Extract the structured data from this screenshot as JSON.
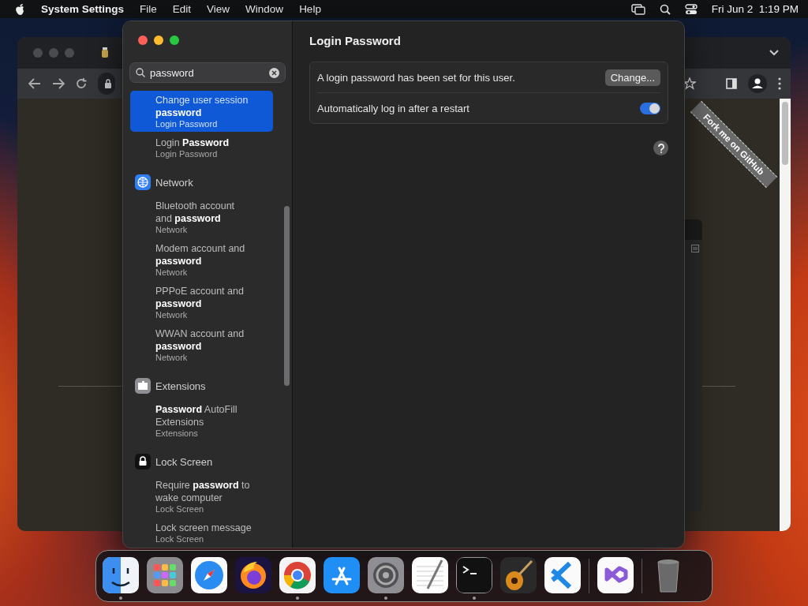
{
  "menu_bar": {
    "app_name": "System Settings",
    "menus": [
      "File",
      "Edit",
      "View",
      "Window",
      "Help"
    ],
    "clock": "Fri Jun 2  1:19 PM"
  },
  "browser": {
    "ribbon": "Fork me on GitHub"
  },
  "settings": {
    "search": {
      "value": "password"
    },
    "groups": [
      {
        "results": [
          {
            "title": "Change user session **password**",
            "subtitle": "Login Password",
            "selected": true
          },
          {
            "title": "Login **Password**",
            "subtitle": "Login Password",
            "selected": false
          }
        ]
      },
      {
        "heading": "Network",
        "results": [
          {
            "title": "Bluetooth account and **password**",
            "subtitle": "Network",
            "selected": false
          },
          {
            "title": "Modem account and **password**",
            "subtitle": "Network",
            "selected": false
          },
          {
            "title": "PPPoE account and **password**",
            "subtitle": "Network",
            "selected": false
          },
          {
            "title": "WWAN account and **password**",
            "subtitle": "Network",
            "selected": false
          }
        ]
      },
      {
        "heading": "Extensions",
        "results": [
          {
            "title": "**Password** AutoFill Extensions",
            "subtitle": "Extensions",
            "selected": false
          }
        ]
      },
      {
        "heading": "Lock Screen",
        "results": [
          {
            "title": "Require **password** to wake computer",
            "subtitle": "Lock Screen",
            "selected": false
          },
          {
            "title": "Lock screen message",
            "subtitle": "Lock Screen",
            "selected": false
          }
        ]
      }
    ],
    "detail": {
      "title": "Login Password",
      "rows": [
        {
          "kind": "button",
          "label": "A login password has been set for this user.",
          "button": "Change..."
        },
        {
          "kind": "toggle",
          "label": "Automatically log in after a restart",
          "on": true
        }
      ]
    }
  },
  "dock": {
    "items": [
      {
        "kind": "app",
        "running": true
      },
      {
        "kind": "app",
        "running": false
      },
      {
        "kind": "app",
        "running": false
      },
      {
        "kind": "app",
        "running": false
      },
      {
        "kind": "app",
        "running": true
      },
      {
        "kind": "app",
        "running": false
      },
      {
        "kind": "app",
        "running": true
      },
      {
        "kind": "app",
        "running": false
      },
      {
        "kind": "app",
        "running": true
      },
      {
        "kind": "app",
        "running": false
      },
      {
        "kind": "app",
        "running": false
      },
      {
        "kind": "separator"
      },
      {
        "kind": "app",
        "running": false
      },
      {
        "kind": "separator"
      },
      {
        "kind": "app",
        "running": false
      }
    ]
  }
}
